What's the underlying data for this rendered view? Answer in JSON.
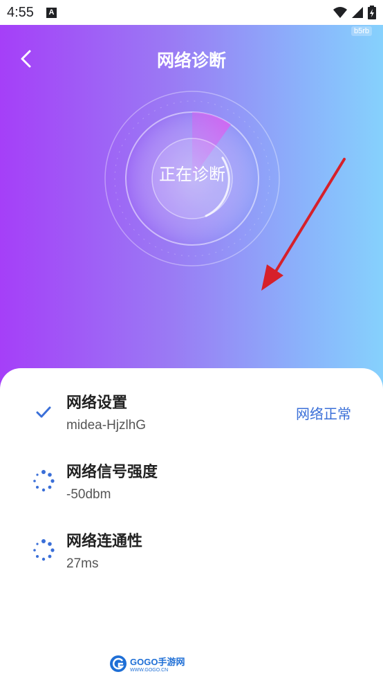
{
  "status_bar": {
    "time": "4:55",
    "notification_icon": "A"
  },
  "header": {
    "title": "网络诊断",
    "badge": "b5rb",
    "back_icon": "chevron-left-icon"
  },
  "radar": {
    "label": "正在诊断"
  },
  "items": [
    {
      "label": "网络设置",
      "value": "midea-HjzlhG",
      "status": "网络正常",
      "icon": "check-icon"
    },
    {
      "label": "网络信号强度",
      "value": "-50dbm",
      "icon": "loading-spinner-icon"
    },
    {
      "label": "网络连通性",
      "value": "27ms",
      "icon": "loading-spinner-icon"
    }
  ],
  "footer": {
    "brand": "GOGO手游网",
    "sub": "WWW.GOGO.CN"
  },
  "colors": {
    "accent": "#3a6fd8",
    "gradient_start": "#a53ff8",
    "gradient_end": "#86d1fd",
    "arrow": "#d6202a"
  }
}
